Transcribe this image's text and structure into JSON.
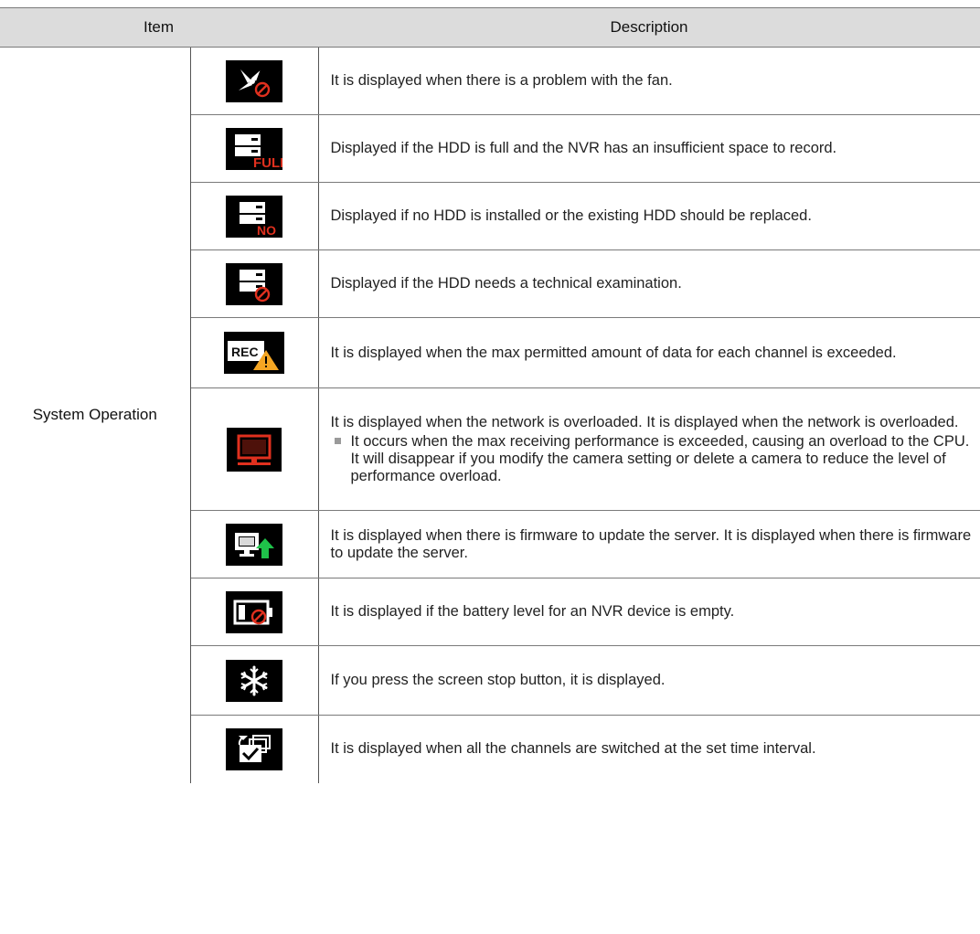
{
  "header": {
    "item": "Item",
    "description": "Description"
  },
  "section": {
    "label": "System Operation"
  },
  "rows": [
    {
      "icon": "fan-error-icon",
      "text": "It is displayed when there is a problem with the fan."
    },
    {
      "icon": "hdd-full-icon",
      "icon_text": "FULL",
      "text": "Displayed if the HDD is full and the NVR has an insufficient space to record."
    },
    {
      "icon": "hdd-missing-icon",
      "icon_text": "NO",
      "text": "Displayed if no HDD is installed or the existing HDD should be replaced."
    },
    {
      "icon": "hdd-error-icon",
      "text": "Displayed if the HDD needs a technical examination."
    },
    {
      "icon": "rec-warning-icon",
      "icon_text": "REC",
      "text": "It is displayed when the max permitted amount of data for each channel is exceeded."
    },
    {
      "icon": "network-overload-icon",
      "text": "It is displayed when the network is overloaded. It is displayed when the network is overloaded.",
      "note": "It occurs when the max receiving performance is exceeded, causing an overload to the CPU. It will disappear if you modify the camera setting or delete a camera to reduce the level of performance overload."
    },
    {
      "icon": "firmware-update-icon",
      "text": "It is displayed when there is firmware to update the server. It is displayed when there is firmware to update the server."
    },
    {
      "icon": "battery-empty-icon",
      "text": "It is displayed if the battery level for an NVR device is empty."
    },
    {
      "icon": "screen-freeze-icon",
      "text": "If you press the screen stop button, it is displayed."
    },
    {
      "icon": "sequence-switch-icon",
      "text": "It is displayed when all the channels are switched at the set time interval."
    }
  ],
  "colors": {
    "header_bg": "#dcdcdc",
    "icon_bg": "#000000",
    "alert_red": "#e0301e",
    "warning_orange": "#f5a623",
    "update_green": "#1fc24a",
    "bullet_gray": "#9a9a9a"
  }
}
